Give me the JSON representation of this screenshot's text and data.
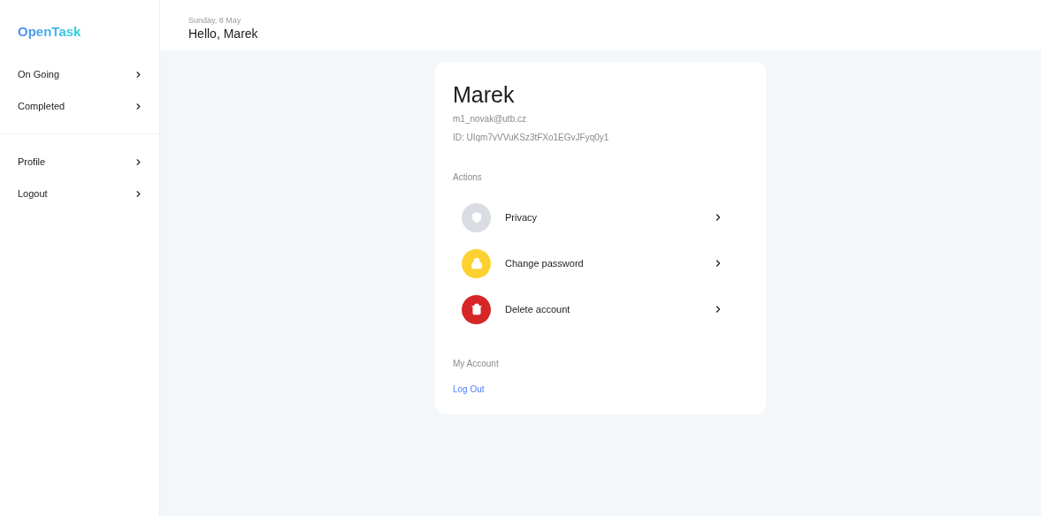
{
  "sidebar": {
    "logo": "OpenTask",
    "groups": [
      [
        {
          "label": "On Going"
        },
        {
          "label": "Completed"
        }
      ],
      [
        {
          "label": "Profile"
        },
        {
          "label": "Logout"
        }
      ]
    ]
  },
  "header": {
    "date": "Sunday, 8 May",
    "greeting": "Hello, Marek"
  },
  "profile": {
    "name": "Marek",
    "email": "m1_novak@utb.cz",
    "id": "ID: UIqm7vVVuKSz3tFXo1EGvJFyq0y1",
    "actions_title": "Actions",
    "actions": [
      {
        "label": "Privacy",
        "kind": "shield",
        "color": "#d9dce3"
      },
      {
        "label": "Change password",
        "kind": "lock",
        "color": "#fdd132"
      },
      {
        "label": "Delete account",
        "kind": "trash",
        "color": "#d62628"
      }
    ],
    "account_title": "My Account",
    "logout_link": "Log Out"
  }
}
